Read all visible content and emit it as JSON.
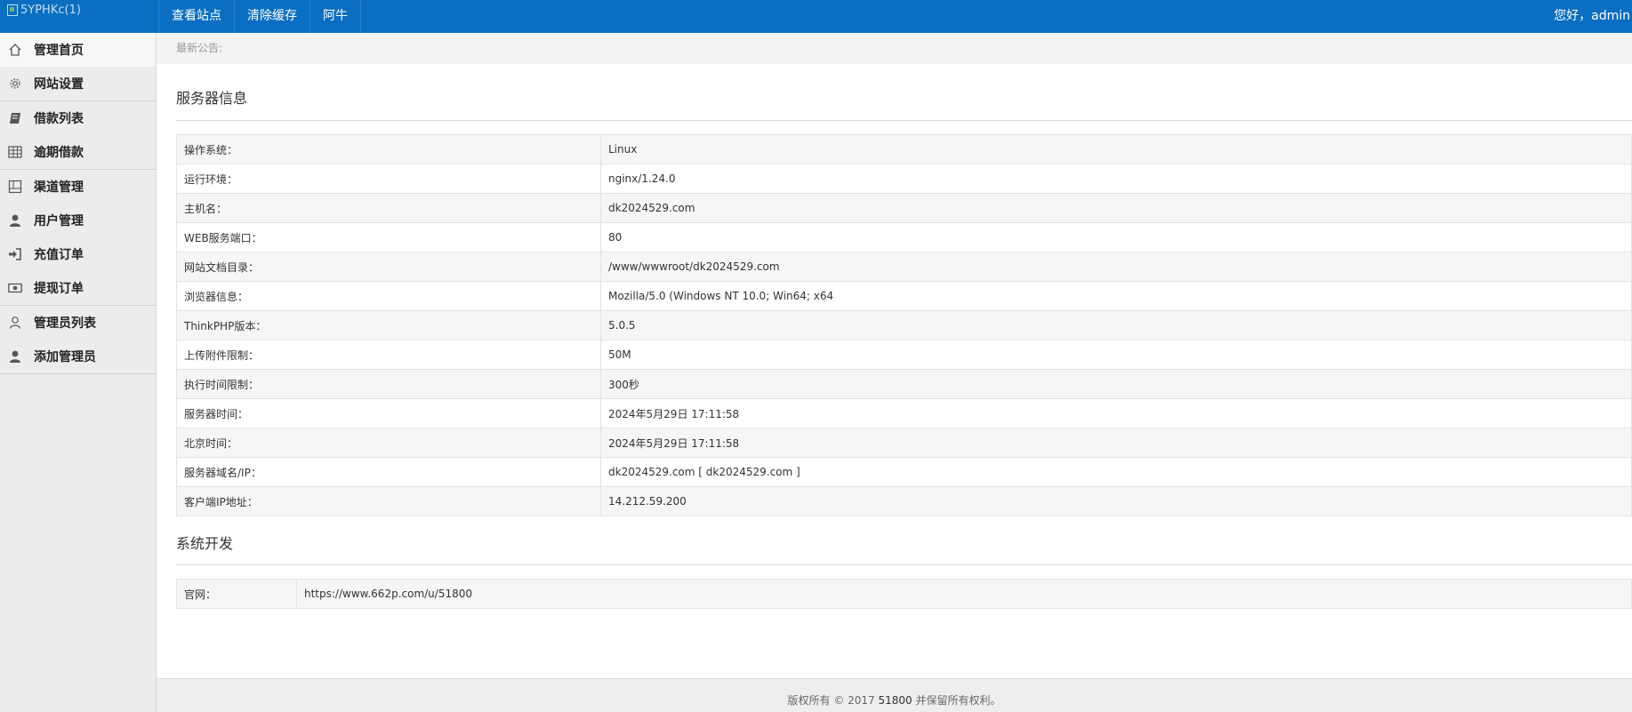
{
  "header": {
    "logo_alt": "5YPHKc(1)",
    "nav": [
      "查看站点",
      "清除缓存",
      "阿牛"
    ],
    "greeting": "您好，admin"
  },
  "sidebar": {
    "groups": [
      [
        {
          "label": "管理首页",
          "icon": "home-icon"
        },
        {
          "label": "网站设置",
          "icon": "gear-icon"
        }
      ],
      [
        {
          "label": "借款列表",
          "icon": "book-icon"
        },
        {
          "label": "逾期借款",
          "icon": "table-icon"
        }
      ],
      [
        {
          "label": "渠道管理",
          "icon": "layout-icon"
        },
        {
          "label": "用户管理",
          "icon": "user-icon"
        },
        {
          "label": "充值订单",
          "icon": "sign-in-icon"
        },
        {
          "label": "提现订单",
          "icon": "money-icon"
        }
      ],
      [
        {
          "label": "管理员列表",
          "icon": "user-outline-icon"
        },
        {
          "label": "添加管理员",
          "icon": "user-icon"
        }
      ]
    ]
  },
  "notice": {
    "label": "最新公告:"
  },
  "server_info": {
    "title": "服务器信息",
    "rows": [
      {
        "k": "操作系统：",
        "v": "Linux"
      },
      {
        "k": "运行环境：",
        "v": "nginx/1.24.0"
      },
      {
        "k": "主机名：",
        "v": "dk2024529.com"
      },
      {
        "k": "WEB服务端口：",
        "v": "80"
      },
      {
        "k": "网站文档目录：",
        "v": "/www/wwwroot/dk2024529.com"
      },
      {
        "k": "浏览器信息：",
        "v": "Mozilla/5.0 (Windows NT 10.0; Win64; x64"
      },
      {
        "k": "ThinkPHP版本：",
        "v": "5.0.5"
      },
      {
        "k": "上传附件限制：",
        "v": "50M"
      },
      {
        "k": "执行时间限制：",
        "v": "300秒"
      },
      {
        "k": "服务器时间：",
        "v": "2024年5月29日 17:11:58"
      },
      {
        "k": "北京时间：",
        "v": "2024年5月29日 17:11:58"
      },
      {
        "k": "服务器域名/IP：",
        "v": "dk2024529.com [ dk2024529.com ]"
      },
      {
        "k": "客户端IP地址：",
        "v": "14.212.59.200"
      }
    ]
  },
  "dev_info": {
    "title": "系统开发",
    "rows": [
      {
        "k": "官网：",
        "v": "https://www.662p.com/u/51800"
      }
    ]
  },
  "footer": {
    "prefix": "版权所有 © 2017 ",
    "num": "51800",
    "suffix": " 并保留所有权利。"
  }
}
